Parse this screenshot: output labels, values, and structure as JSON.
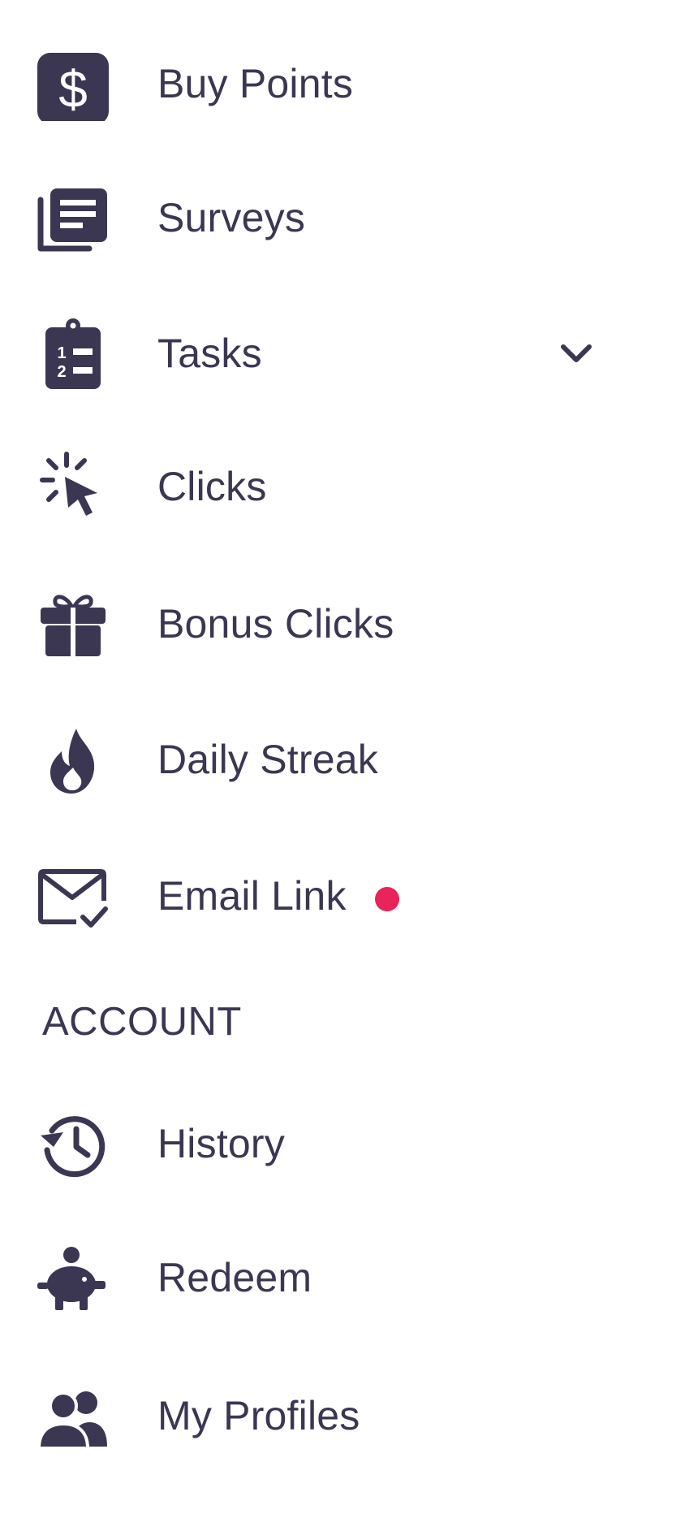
{
  "menu": {
    "items": [
      {
        "label": "Buy Points",
        "icon": "dollar-icon"
      },
      {
        "label": "Surveys",
        "icon": "survey-list-icon"
      },
      {
        "label": "Tasks",
        "icon": "clipboard-list-icon",
        "expandable": true
      },
      {
        "label": "Clicks",
        "icon": "cursor-click-icon"
      },
      {
        "label": "Bonus Clicks",
        "icon": "gift-icon"
      },
      {
        "label": "Daily Streak",
        "icon": "flame-icon"
      },
      {
        "label": "Email Link",
        "icon": "email-check-icon",
        "notification": true
      }
    ],
    "account_header": "ACCOUNT",
    "account_items": [
      {
        "label": "History",
        "icon": "history-icon"
      },
      {
        "label": "Redeem",
        "icon": "piggy-bank-icon"
      },
      {
        "label": "My Profiles",
        "icon": "people-icon"
      }
    ]
  },
  "colors": {
    "text": "#3b3752",
    "icon": "#3b3752",
    "notification_dot": "#e8245a",
    "background": "#ffffff"
  }
}
